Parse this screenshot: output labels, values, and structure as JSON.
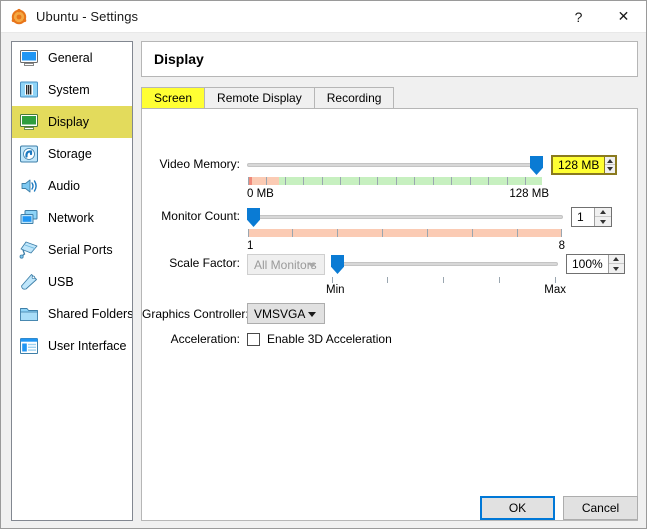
{
  "window": {
    "title": "Ubuntu - Settings",
    "icon": "ubuntu-logo-icon",
    "help_glyph": "?",
    "close_glyph": "✕"
  },
  "sidebar": {
    "items": [
      {
        "label": "General",
        "icon": "monitor-icon",
        "selected": false
      },
      {
        "label": "System",
        "icon": "chip-icon",
        "selected": false
      },
      {
        "label": "Display",
        "icon": "display-icon",
        "selected": true
      },
      {
        "label": "Storage",
        "icon": "harddisk-icon",
        "selected": false
      },
      {
        "label": "Audio",
        "icon": "speaker-icon",
        "selected": false
      },
      {
        "label": "Network",
        "icon": "network-cards-icon",
        "selected": false
      },
      {
        "label": "Serial Ports",
        "icon": "serial-port-icon",
        "selected": false
      },
      {
        "label": "USB",
        "icon": "usb-plug-icon",
        "selected": false
      },
      {
        "label": "Shared Folders",
        "icon": "folder-icon",
        "selected": false
      },
      {
        "label": "User Interface",
        "icon": "window-panel-icon",
        "selected": false
      }
    ]
  },
  "main": {
    "header_title": "Display",
    "tabs": [
      {
        "label": "Screen",
        "active": true
      },
      {
        "label": "Remote Display",
        "active": false
      },
      {
        "label": "Recording",
        "active": false
      }
    ],
    "fields": {
      "video_memory": {
        "label": "Video Memory:",
        "value": "128 MB",
        "min_label": "0 MB",
        "max_label": "128 MB",
        "slider_percent": 100,
        "tick_count": 16,
        "highlighted": true
      },
      "monitor_count": {
        "label": "Monitor Count:",
        "value": "1",
        "min_label": "1",
        "max_label": "8",
        "slider_percent": 0,
        "tick_count": 8,
        "highlighted": false
      },
      "scale_factor": {
        "label": "Scale Factor:",
        "monitor_select": "All Monitors",
        "monitor_select_disabled": true,
        "value": "100%",
        "min_label": "Min",
        "max_label": "Max",
        "slider_percent": 0,
        "tick_count": 5
      },
      "graphics_controller": {
        "label": "Graphics Controller:",
        "value": "VMSVGA"
      },
      "acceleration": {
        "label": "Acceleration:",
        "checkbox_label": "Enable 3D Acceleration",
        "checked": false
      }
    }
  },
  "footer": {
    "ok_label": "OK",
    "cancel_label": "Cancel"
  },
  "colors": {
    "selection": "#e3db5c",
    "tab_active": "#ffff33",
    "slider_handle": "#0a7bd4",
    "bar_green": "#c7f0c0",
    "bar_salmon": "#fbcbb4",
    "bar_red": "#f08a7a",
    "focus_blue": "#0078d7"
  }
}
